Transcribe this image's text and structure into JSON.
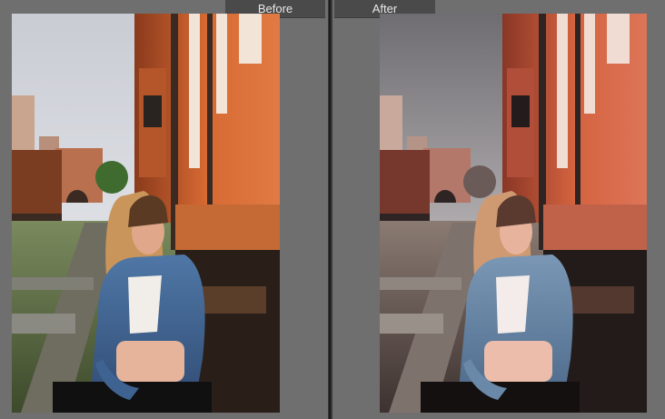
{
  "labels": {
    "before": "Before",
    "after": "After"
  },
  "photos": {
    "before": {
      "description_icon": "photo-before"
    },
    "after": {
      "description_icon": "photo-after"
    }
  },
  "colors": {
    "background": "#6f6f6f",
    "label_bg": "#4a4a4a",
    "label_text": "#e8e8e8",
    "train_before": "#d2652f",
    "train_after": "#cf5a3c",
    "denim_before": "#3d5f8f",
    "denim_after": "#5a7fa2"
  }
}
